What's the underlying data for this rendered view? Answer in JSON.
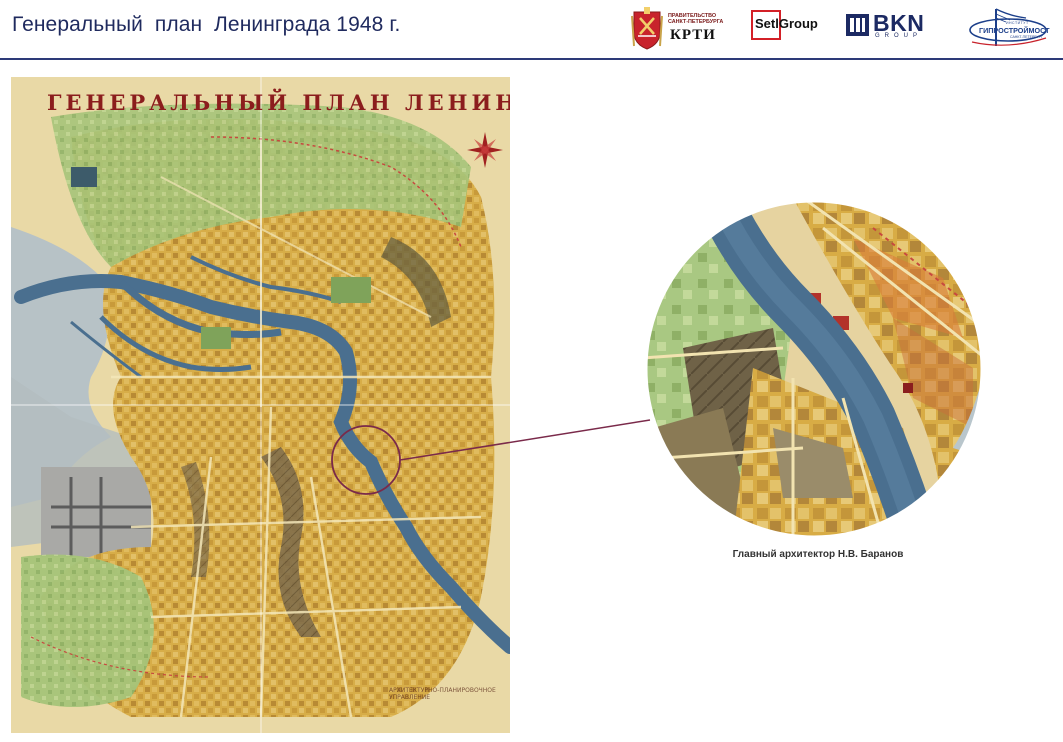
{
  "header": {
    "title": "Генеральный  план  Ленинграда 1948 г."
  },
  "logos": {
    "krti": {
      "small_text": "ПРАВИТЕЛЬСТВО САНКТ-ПЕТЕРБУРГА",
      "big_text": "КРТИ"
    },
    "setl": {
      "text": "SetlGroup"
    },
    "bkn": {
      "text": "BKN",
      "sub": "GROUP"
    },
    "gipro": {
      "small": "ИНСТИТУТ",
      "text": "ГИПРОСТРОЙМОСТ",
      "sub": "САНКТ-ПЕТЕРБУРГ"
    }
  },
  "map": {
    "title": "ГЕНЕРАЛЬНЫЙ ПЛАН ЛЕНИНГРАДА",
    "stamp_text": "АРХИТЕКТУРНО-ПЛАНИРОВОЧНОЕ УПРАВЛЕНИЕ"
  },
  "caption": {
    "text": "Главный архитектор Н.В. Баранов"
  },
  "colors": {
    "title_blue": "#1f2a5e",
    "header_rule": "#2d3a78",
    "map_title_red": "#8b1d1d",
    "river": "#4a6f8f",
    "parchment": "#e9d9a6",
    "block_yellow": "#d9b24a",
    "green_space": "#9bbf6e",
    "highlight_circle": "#7a2a4a"
  }
}
